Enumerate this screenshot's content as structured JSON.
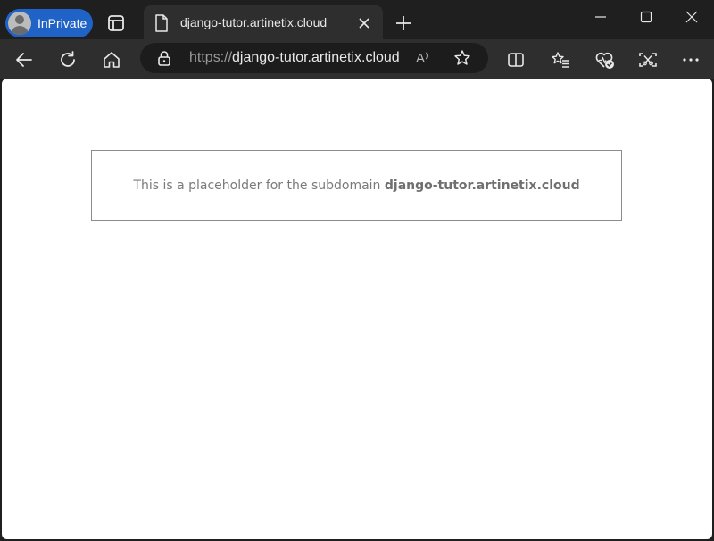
{
  "titlebar": {
    "inprivate_label": "InPrivate",
    "tab_title": "django-tutor.artinetix.cloud"
  },
  "toolbar": {
    "url_scheme": "https://",
    "url_host": "django-tutor.artinetix.cloud",
    "read_aloud_glyph": "A⁾"
  },
  "page": {
    "placeholder_prefix": "This is a placeholder for the subdomain ",
    "placeholder_domain": "django-tutor.artinetix.cloud"
  },
  "colors": {
    "inprivate_badge": "#1f63c6",
    "chrome_dark": "#1f1f1f",
    "toolbar": "#2e2e2e",
    "page_bg": "#ffffff"
  }
}
